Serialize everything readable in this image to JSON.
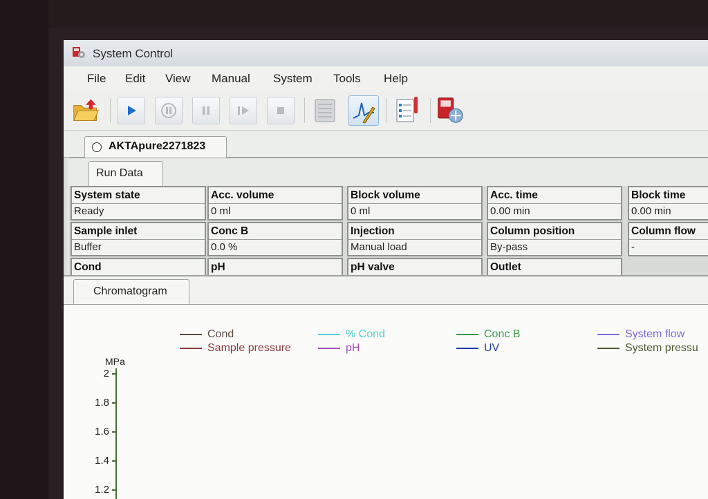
{
  "window": {
    "title": "System Control"
  },
  "menu": [
    "File",
    "Edit",
    "View",
    "Manual",
    "System",
    "Tools",
    "Help"
  ],
  "toolbar": {
    "buttons": [
      "open-folder-icon",
      "run-icon",
      "pause-hold-icon",
      "pause-icon",
      "continue-icon",
      "stop-icon",
      "log-book-icon",
      "chromatogram-customize-icon",
      "method-checklist-icon",
      "system-connect-icon"
    ]
  },
  "system_tab": {
    "label": "AKTApure2271823"
  },
  "run_data": {
    "tab_label": "Run Data",
    "cells": [
      {
        "header": "System state",
        "value": "Ready"
      },
      {
        "header": "Acc. volume",
        "value": "0 ml"
      },
      {
        "header": "Block volume",
        "value": "0 ml"
      },
      {
        "header": "Acc. time",
        "value": "0.00 min"
      },
      {
        "header": "Block time",
        "value": "0.00 min"
      },
      {
        "header": "Sample inlet",
        "value": "Buffer"
      },
      {
        "header": "Conc B",
        "value": "0.0 %"
      },
      {
        "header": "Injection",
        "value": "Manual load"
      },
      {
        "header": "Column position",
        "value": "By-pass"
      },
      {
        "header": "Column flow",
        "value": "-"
      },
      {
        "header": "Cond",
        "value": ""
      },
      {
        "header": "pH",
        "value": ""
      },
      {
        "header": "pH valve",
        "value": ""
      },
      {
        "header": "Outlet",
        "value": ""
      }
    ]
  },
  "chromatogram": {
    "tab_label": "Chromatogram",
    "legend": [
      {
        "label": "Cond",
        "color": "#5a4a3f"
      },
      {
        "label": "Sample pressure",
        "color": "#8a3b3b"
      },
      {
        "label": "% Cond",
        "color": "#4fd0d0"
      },
      {
        "label": "pH",
        "color": "#a050b8"
      },
      {
        "label": "Conc B",
        "color": "#3a9a4a"
      },
      {
        "label": "UV",
        "color": "#1f3aa8"
      },
      {
        "label": "System flow",
        "color": "#7a6ad8"
      },
      {
        "label": "System pressu",
        "color": "#4a5a2a"
      }
    ],
    "y_unit": "MPa",
    "y_ticks": [
      "2",
      "1.8",
      "1.6",
      "1.4",
      "1.2"
    ]
  },
  "chart_data": {
    "type": "line",
    "ylabel": "MPa",
    "ylim": [
      1.2,
      2
    ],
    "y_ticks": [
      2,
      1.8,
      1.6,
      1.4,
      1.2
    ],
    "series": [
      {
        "name": "Cond",
        "values": []
      },
      {
        "name": "Sample pressure",
        "values": []
      },
      {
        "name": "% Cond",
        "values": []
      },
      {
        "name": "pH",
        "values": []
      },
      {
        "name": "Conc B",
        "values": []
      },
      {
        "name": "UV",
        "values": []
      },
      {
        "name": "System flow",
        "values": []
      },
      {
        "name": "System pressu",
        "values": []
      }
    ]
  }
}
